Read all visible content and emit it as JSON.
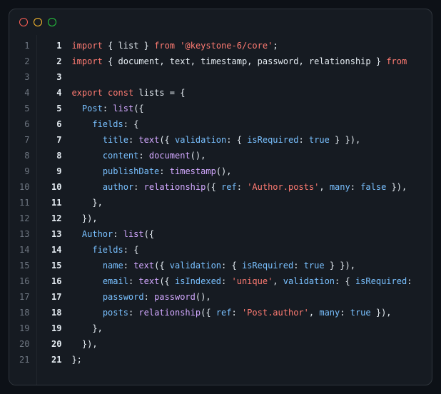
{
  "gutter": [
    "1",
    "2",
    "3",
    "4",
    "5",
    "6",
    "7",
    "8",
    "9",
    "10",
    "11",
    "12",
    "13",
    "14",
    "15",
    "16",
    "17",
    "18",
    "19",
    "20",
    "21"
  ],
  "lines": [
    {
      "num": "1",
      "tokens": [
        {
          "t": "import",
          "c": "tok-kw"
        },
        {
          "t": " ",
          "c": "tok-punc"
        },
        {
          "t": "{",
          "c": "tok-punc"
        },
        {
          "t": " ",
          "c": "tok-punc"
        },
        {
          "t": "list",
          "c": "tok-ident"
        },
        {
          "t": " ",
          "c": "tok-punc"
        },
        {
          "t": "}",
          "c": "tok-punc"
        },
        {
          "t": " ",
          "c": "tok-punc"
        },
        {
          "t": "from",
          "c": "tok-from"
        },
        {
          "t": " ",
          "c": "tok-punc"
        },
        {
          "t": "'@keystone-6/core'",
          "c": "tok-str"
        },
        {
          "t": ";",
          "c": "tok-punc"
        }
      ]
    },
    {
      "num": "2",
      "tokens": [
        {
          "t": "import",
          "c": "tok-kw"
        },
        {
          "t": " ",
          "c": "tok-punc"
        },
        {
          "t": "{",
          "c": "tok-punc"
        },
        {
          "t": " ",
          "c": "tok-punc"
        },
        {
          "t": "document",
          "c": "tok-ident"
        },
        {
          "t": ",",
          "c": "tok-punc"
        },
        {
          "t": " ",
          "c": "tok-punc"
        },
        {
          "t": "text",
          "c": "tok-ident"
        },
        {
          "t": ",",
          "c": "tok-punc"
        },
        {
          "t": " ",
          "c": "tok-punc"
        },
        {
          "t": "timestamp",
          "c": "tok-ident"
        },
        {
          "t": ",",
          "c": "tok-punc"
        },
        {
          "t": " ",
          "c": "tok-punc"
        },
        {
          "t": "password",
          "c": "tok-ident"
        },
        {
          "t": ",",
          "c": "tok-punc"
        },
        {
          "t": " ",
          "c": "tok-punc"
        },
        {
          "t": "relationship",
          "c": "tok-ident"
        },
        {
          "t": " ",
          "c": "tok-punc"
        },
        {
          "t": "}",
          "c": "tok-punc"
        },
        {
          "t": " ",
          "c": "tok-punc"
        },
        {
          "t": "from",
          "c": "tok-from"
        }
      ]
    },
    {
      "num": "3",
      "tokens": []
    },
    {
      "num": "4",
      "tokens": [
        {
          "t": "export",
          "c": "tok-kw"
        },
        {
          "t": " ",
          "c": "tok-punc"
        },
        {
          "t": "const",
          "c": "tok-const"
        },
        {
          "t": " ",
          "c": "tok-punc"
        },
        {
          "t": "lists",
          "c": "tok-var"
        },
        {
          "t": " ",
          "c": "tok-punc"
        },
        {
          "t": "=",
          "c": "tok-punc"
        },
        {
          "t": " ",
          "c": "tok-punc"
        },
        {
          "t": "{",
          "c": "tok-punc"
        }
      ]
    },
    {
      "num": "5",
      "tokens": [
        {
          "t": "  ",
          "c": "tok-punc"
        },
        {
          "t": "Post",
          "c": "tok-prop"
        },
        {
          "t": ":",
          "c": "tok-punc"
        },
        {
          "t": " ",
          "c": "tok-punc"
        },
        {
          "t": "list",
          "c": "tok-func"
        },
        {
          "t": "({",
          "c": "tok-punc"
        }
      ]
    },
    {
      "num": "6",
      "tokens": [
        {
          "t": "    ",
          "c": "tok-punc"
        },
        {
          "t": "fields",
          "c": "tok-prop"
        },
        {
          "t": ":",
          "c": "tok-punc"
        },
        {
          "t": " ",
          "c": "tok-punc"
        },
        {
          "t": "{",
          "c": "tok-punc"
        }
      ]
    },
    {
      "num": "7",
      "tokens": [
        {
          "t": "      ",
          "c": "tok-punc"
        },
        {
          "t": "title",
          "c": "tok-prop"
        },
        {
          "t": ":",
          "c": "tok-punc"
        },
        {
          "t": " ",
          "c": "tok-punc"
        },
        {
          "t": "text",
          "c": "tok-func"
        },
        {
          "t": "({",
          "c": "tok-punc"
        },
        {
          "t": " ",
          "c": "tok-punc"
        },
        {
          "t": "validation",
          "c": "tok-prop"
        },
        {
          "t": ":",
          "c": "tok-punc"
        },
        {
          "t": " ",
          "c": "tok-punc"
        },
        {
          "t": "{",
          "c": "tok-punc"
        },
        {
          "t": " ",
          "c": "tok-punc"
        },
        {
          "t": "isRequired",
          "c": "tok-prop"
        },
        {
          "t": ":",
          "c": "tok-punc"
        },
        {
          "t": " ",
          "c": "tok-punc"
        },
        {
          "t": "true",
          "c": "tok-bool"
        },
        {
          "t": " ",
          "c": "tok-punc"
        },
        {
          "t": "}",
          "c": "tok-punc"
        },
        {
          "t": " ",
          "c": "tok-punc"
        },
        {
          "t": "}),",
          "c": "tok-punc"
        }
      ]
    },
    {
      "num": "8",
      "tokens": [
        {
          "t": "      ",
          "c": "tok-punc"
        },
        {
          "t": "content",
          "c": "tok-prop"
        },
        {
          "t": ":",
          "c": "tok-punc"
        },
        {
          "t": " ",
          "c": "tok-punc"
        },
        {
          "t": "document",
          "c": "tok-func"
        },
        {
          "t": "(),",
          "c": "tok-punc"
        }
      ]
    },
    {
      "num": "9",
      "tokens": [
        {
          "t": "      ",
          "c": "tok-punc"
        },
        {
          "t": "publishDate",
          "c": "tok-prop"
        },
        {
          "t": ":",
          "c": "tok-punc"
        },
        {
          "t": " ",
          "c": "tok-punc"
        },
        {
          "t": "timestamp",
          "c": "tok-func"
        },
        {
          "t": "(),",
          "c": "tok-punc"
        }
      ]
    },
    {
      "num": "10",
      "tokens": [
        {
          "t": "      ",
          "c": "tok-punc"
        },
        {
          "t": "author",
          "c": "tok-prop"
        },
        {
          "t": ":",
          "c": "tok-punc"
        },
        {
          "t": " ",
          "c": "tok-punc"
        },
        {
          "t": "relationship",
          "c": "tok-func"
        },
        {
          "t": "({",
          "c": "tok-punc"
        },
        {
          "t": " ",
          "c": "tok-punc"
        },
        {
          "t": "ref",
          "c": "tok-prop"
        },
        {
          "t": ":",
          "c": "tok-punc"
        },
        {
          "t": " ",
          "c": "tok-punc"
        },
        {
          "t": "'Author.posts'",
          "c": "tok-str"
        },
        {
          "t": ",",
          "c": "tok-punc"
        },
        {
          "t": " ",
          "c": "tok-punc"
        },
        {
          "t": "many",
          "c": "tok-prop"
        },
        {
          "t": ":",
          "c": "tok-punc"
        },
        {
          "t": " ",
          "c": "tok-punc"
        },
        {
          "t": "false",
          "c": "tok-bool"
        },
        {
          "t": " ",
          "c": "tok-punc"
        },
        {
          "t": "}),",
          "c": "tok-punc"
        }
      ]
    },
    {
      "num": "11",
      "tokens": [
        {
          "t": "    ",
          "c": "tok-punc"
        },
        {
          "t": "},",
          "c": "tok-punc"
        }
      ]
    },
    {
      "num": "12",
      "tokens": [
        {
          "t": "  ",
          "c": "tok-punc"
        },
        {
          "t": "}),",
          "c": "tok-punc"
        }
      ]
    },
    {
      "num": "13",
      "tokens": [
        {
          "t": "  ",
          "c": "tok-punc"
        },
        {
          "t": "Author",
          "c": "tok-prop"
        },
        {
          "t": ":",
          "c": "tok-punc"
        },
        {
          "t": " ",
          "c": "tok-punc"
        },
        {
          "t": "list",
          "c": "tok-func"
        },
        {
          "t": "({",
          "c": "tok-punc"
        }
      ]
    },
    {
      "num": "14",
      "tokens": [
        {
          "t": "    ",
          "c": "tok-punc"
        },
        {
          "t": "fields",
          "c": "tok-prop"
        },
        {
          "t": ":",
          "c": "tok-punc"
        },
        {
          "t": " ",
          "c": "tok-punc"
        },
        {
          "t": "{",
          "c": "tok-punc"
        }
      ]
    },
    {
      "num": "15",
      "tokens": [
        {
          "t": "      ",
          "c": "tok-punc"
        },
        {
          "t": "name",
          "c": "tok-prop"
        },
        {
          "t": ":",
          "c": "tok-punc"
        },
        {
          "t": " ",
          "c": "tok-punc"
        },
        {
          "t": "text",
          "c": "tok-func"
        },
        {
          "t": "({",
          "c": "tok-punc"
        },
        {
          "t": " ",
          "c": "tok-punc"
        },
        {
          "t": "validation",
          "c": "tok-prop"
        },
        {
          "t": ":",
          "c": "tok-punc"
        },
        {
          "t": " ",
          "c": "tok-punc"
        },
        {
          "t": "{",
          "c": "tok-punc"
        },
        {
          "t": " ",
          "c": "tok-punc"
        },
        {
          "t": "isRequired",
          "c": "tok-prop"
        },
        {
          "t": ":",
          "c": "tok-punc"
        },
        {
          "t": " ",
          "c": "tok-punc"
        },
        {
          "t": "true",
          "c": "tok-bool"
        },
        {
          "t": " ",
          "c": "tok-punc"
        },
        {
          "t": "}",
          "c": "tok-punc"
        },
        {
          "t": " ",
          "c": "tok-punc"
        },
        {
          "t": "}),",
          "c": "tok-punc"
        }
      ]
    },
    {
      "num": "16",
      "tokens": [
        {
          "t": "      ",
          "c": "tok-punc"
        },
        {
          "t": "email",
          "c": "tok-prop"
        },
        {
          "t": ":",
          "c": "tok-punc"
        },
        {
          "t": " ",
          "c": "tok-punc"
        },
        {
          "t": "text",
          "c": "tok-func"
        },
        {
          "t": "({",
          "c": "tok-punc"
        },
        {
          "t": " ",
          "c": "tok-punc"
        },
        {
          "t": "isIndexed",
          "c": "tok-prop"
        },
        {
          "t": ":",
          "c": "tok-punc"
        },
        {
          "t": " ",
          "c": "tok-punc"
        },
        {
          "t": "'unique'",
          "c": "tok-str"
        },
        {
          "t": ",",
          "c": "tok-punc"
        },
        {
          "t": " ",
          "c": "tok-punc"
        },
        {
          "t": "validation",
          "c": "tok-prop"
        },
        {
          "t": ":",
          "c": "tok-punc"
        },
        {
          "t": " ",
          "c": "tok-punc"
        },
        {
          "t": "{",
          "c": "tok-punc"
        },
        {
          "t": " ",
          "c": "tok-punc"
        },
        {
          "t": "isRequired",
          "c": "tok-prop"
        },
        {
          "t": ":",
          "c": "tok-punc"
        }
      ]
    },
    {
      "num": "17",
      "tokens": [
        {
          "t": "      ",
          "c": "tok-punc"
        },
        {
          "t": "password",
          "c": "tok-prop"
        },
        {
          "t": ":",
          "c": "tok-punc"
        },
        {
          "t": " ",
          "c": "tok-punc"
        },
        {
          "t": "password",
          "c": "tok-func"
        },
        {
          "t": "(),",
          "c": "tok-punc"
        }
      ]
    },
    {
      "num": "18",
      "tokens": [
        {
          "t": "      ",
          "c": "tok-punc"
        },
        {
          "t": "posts",
          "c": "tok-prop"
        },
        {
          "t": ":",
          "c": "tok-punc"
        },
        {
          "t": " ",
          "c": "tok-punc"
        },
        {
          "t": "relationship",
          "c": "tok-func"
        },
        {
          "t": "({",
          "c": "tok-punc"
        },
        {
          "t": " ",
          "c": "tok-punc"
        },
        {
          "t": "ref",
          "c": "tok-prop"
        },
        {
          "t": ":",
          "c": "tok-punc"
        },
        {
          "t": " ",
          "c": "tok-punc"
        },
        {
          "t": "'Post.author'",
          "c": "tok-str"
        },
        {
          "t": ",",
          "c": "tok-punc"
        },
        {
          "t": " ",
          "c": "tok-punc"
        },
        {
          "t": "many",
          "c": "tok-prop"
        },
        {
          "t": ":",
          "c": "tok-punc"
        },
        {
          "t": " ",
          "c": "tok-punc"
        },
        {
          "t": "true",
          "c": "tok-bool"
        },
        {
          "t": " ",
          "c": "tok-punc"
        },
        {
          "t": "}),",
          "c": "tok-punc"
        }
      ]
    },
    {
      "num": "19",
      "tokens": [
        {
          "t": "    ",
          "c": "tok-punc"
        },
        {
          "t": "},",
          "c": "tok-punc"
        }
      ]
    },
    {
      "num": "20",
      "tokens": [
        {
          "t": "  ",
          "c": "tok-punc"
        },
        {
          "t": "}),",
          "c": "tok-punc"
        }
      ]
    },
    {
      "num": "21",
      "tokens": [
        {
          "t": "};",
          "c": "tok-punc"
        }
      ]
    }
  ]
}
